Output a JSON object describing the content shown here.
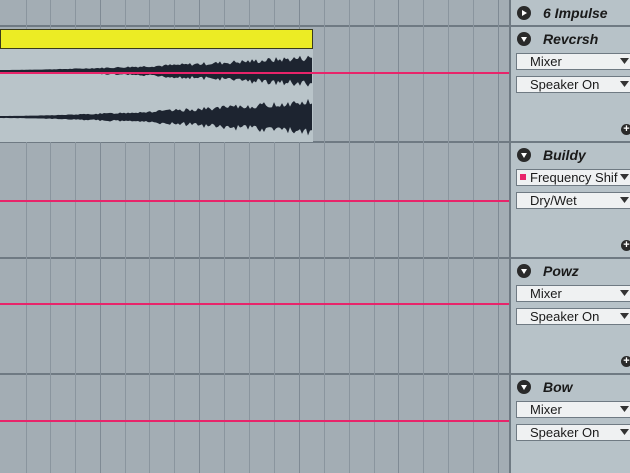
{
  "colors": {
    "automation": "#e8246a",
    "clip_header": "#ecec24",
    "waveform": "#1d2430",
    "lane": "#a3adb4",
    "panel": "#b7c2c8"
  },
  "tracks": [
    {
      "name": "6 Impulse",
      "collapsed": true
    },
    {
      "name": "Revcrsh",
      "device": "Mixer",
      "parameter": "Speaker On"
    },
    {
      "name": "Buildy",
      "device": "Frequency Shif",
      "parameter": "Dry/Wet",
      "device_active": true
    },
    {
      "name": "Powz",
      "device": "Mixer",
      "parameter": "Speaker On"
    },
    {
      "name": "Bow",
      "device": "Mixer",
      "parameter": "Speaker On"
    }
  ],
  "icons": {
    "collapsed": "triangle-right-icon",
    "expanded": "triangle-down-icon",
    "dropdown": "chevron-down-icon",
    "add": "plus-icon"
  }
}
